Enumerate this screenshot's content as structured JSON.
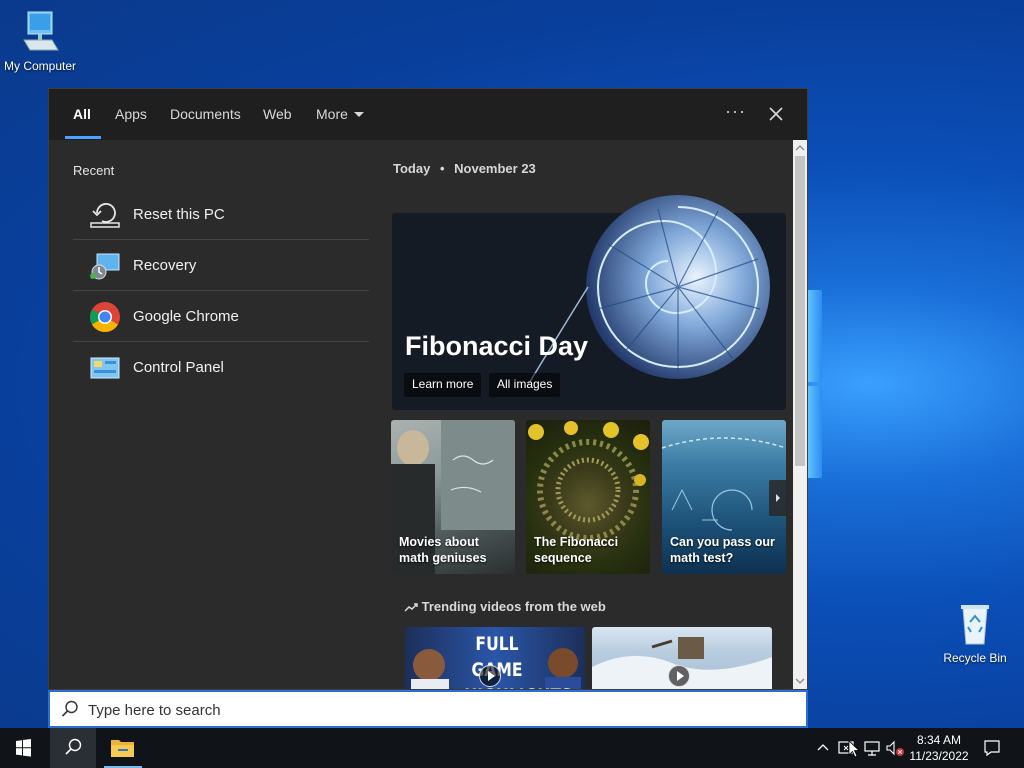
{
  "desktop": {
    "icons": [
      {
        "label": "My Computer",
        "icon": "computer-icon"
      },
      {
        "label": "Recycle Bin",
        "icon": "recycle-bin-icon"
      }
    ]
  },
  "search_panel": {
    "tabs": [
      {
        "label": "All",
        "active": true
      },
      {
        "label": "Apps"
      },
      {
        "label": "Documents"
      },
      {
        "label": "Web"
      },
      {
        "label": "More"
      }
    ],
    "options_label": "···",
    "recent": {
      "title": "Recent",
      "items": [
        {
          "label": "Reset this PC",
          "icon": "reset-pc-icon"
        },
        {
          "label": "Recovery",
          "icon": "recovery-icon"
        },
        {
          "label": "Google Chrome",
          "icon": "chrome-icon"
        },
        {
          "label": "Control Panel",
          "icon": "control-panel-icon"
        }
      ]
    },
    "today": {
      "label": "Today",
      "separator": "•",
      "date": "November 23",
      "hero": {
        "title": "Fibonacci Day",
        "learn_more": "Learn more",
        "all_images": "All images"
      },
      "cards": [
        {
          "caption": "Movies about math geniuses"
        },
        {
          "caption": "The Fibonacci sequence"
        },
        {
          "caption": "Can you pass our math test?"
        }
      ],
      "trending_label": "Trending videos from the web",
      "videos": [
        {
          "title": "FULL GAME HIGHLIGHTS"
        },
        {
          "title": ""
        }
      ]
    }
  },
  "searchbox": {
    "placeholder": "Type here to search"
  },
  "taskbar": {
    "time": "8:34 AM",
    "date": "11/23/2022"
  },
  "colors": {
    "accent": "#4aa3ff",
    "panel_bg": "#2b2b2b",
    "taskbar_bg": "#101418"
  }
}
